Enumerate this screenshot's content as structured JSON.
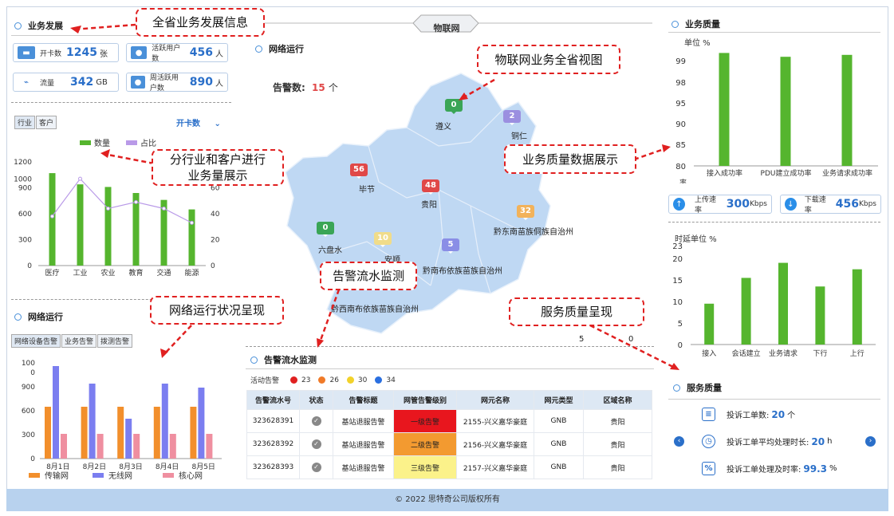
{
  "left": {
    "business": {
      "title": "业务发展",
      "cards": [
        {
          "label": "开卡数",
          "value": "1245",
          "unit": "张",
          "icon": "card-icon"
        },
        {
          "label": "活跃用户数",
          "value": "456",
          "unit": "人",
          "icon": "user-icon"
        },
        {
          "label": "流量",
          "value": "342",
          "unit": "GB",
          "icon": "pulse-icon"
        },
        {
          "label": "周活跃用户数",
          "value": "890",
          "unit": "人",
          "icon": "user-week-icon"
        }
      ],
      "tabs": [
        "行业",
        "客户"
      ],
      "dropdown": "开卡数"
    },
    "network": {
      "title": "网络运行",
      "tabs": [
        "网络设备告警",
        "业务告警",
        "拨测告警"
      ]
    }
  },
  "center": {
    "banner": "物联网",
    "network_title": "网络运行",
    "alarm_label": "告警数:",
    "alarm_value": "15",
    "alarm_unit": "个",
    "map": {
      "regions": [
        {
          "name": "遵义",
          "count": "0",
          "color": "#3aa556"
        },
        {
          "name": "铜仁",
          "count": "2",
          "color": "#9b8fe0"
        },
        {
          "name": "毕节",
          "count": "56",
          "color": "#e04848"
        },
        {
          "name": "贵阳",
          "count": "48",
          "color": "#e04848"
        },
        {
          "name": "黔东南苗族侗族自治州",
          "count": "32",
          "color": "#f2b25a"
        },
        {
          "name": "六盘水",
          "count": "0",
          "color": "#3aa556"
        },
        {
          "name": "安顺",
          "count": "10",
          "color": "#f0dc8a"
        },
        {
          "name": "黔南布依族苗族自治州",
          "count": "5",
          "color": "#8a8ee6"
        },
        {
          "name": "黔西南布依族苗族自治州",
          "count": "",
          "color": ""
        }
      ],
      "scale_values": [
        "5",
        "0"
      ]
    },
    "alarm_stream": {
      "title": "告警流水监测",
      "active_label": "活动告警",
      "legend": [
        {
          "value": "23",
          "color": "#e02020"
        },
        {
          "value": "26",
          "color": "#f07a28"
        },
        {
          "value": "30",
          "color": "#f2d22a"
        },
        {
          "value": "34",
          "color": "#2a6fe0"
        }
      ],
      "columns": [
        "告警流水号",
        "状态",
        "告警标题",
        "网管告警级别",
        "网元名称",
        "网元类型",
        "区域名称"
      ],
      "rows": [
        {
          "id": "323628391",
          "title": "基站退服告警",
          "level": "一级告警",
          "level_color": "#e8161e",
          "ne": "2155-兴义嘉华豪庭",
          "type": "GNB",
          "area": "贵阳"
        },
        {
          "id": "323628392",
          "title": "基站退服告警",
          "level": "二级告警",
          "level_color": "#f39a30",
          "ne": "2156-兴义嘉华豪庭",
          "type": "GNB",
          "area": "贵阳"
        },
        {
          "id": "323628393",
          "title": "基站退服告警",
          "level": "三级告警",
          "level_color": "#fbf28a",
          "ne": "2157-兴义嘉华豪庭",
          "type": "GNB",
          "area": "贵阳"
        }
      ]
    }
  },
  "right": {
    "quality": {
      "title": "业务质量",
      "unit": "单位 %",
      "upload_label": "上传速率",
      "upload_value": "300",
      "upload_unit": "Kbps",
      "download_label": "下载速率",
      "download_value": "456",
      "download_unit": "Kbps",
      "delay_unit": "时延单位 %"
    },
    "service": {
      "title": "服务质量",
      "items": [
        {
          "label": "投诉工单数:",
          "value": "20",
          "unit": "个",
          "icon": "clipboard-icon"
        },
        {
          "label": "投诉工单平均处理时长:",
          "value": "20",
          "unit": "h",
          "icon": "clock-icon"
        },
        {
          "label": "投诉工单处理及时率:",
          "value": "99.3",
          "unit": "%",
          "icon": "percent-icon"
        }
      ]
    }
  },
  "callouts": {
    "province": "全省业务发展信息",
    "industry": "分行业和客户进行\n业务量展示",
    "net_status": "网络运行状况呈现",
    "iot_view": "物联网业务全省视图",
    "quality_show": "业务质量数据展示",
    "alarm_monitor": "告警流水监测",
    "service_show": "服务质量呈现"
  },
  "footer": "© 2022 思特奇公司版权所有",
  "chart_data": [
    {
      "type": "bar",
      "title": "",
      "categories": [
        "医疗",
        "工业",
        "农业",
        "教育",
        "交通",
        "能源"
      ],
      "series": [
        {
          "name": "数量",
          "values": [
            1070,
            940,
            910,
            840,
            760,
            650
          ],
          "color": "#55b52e"
        },
        {
          "name": "占比",
          "type": "line",
          "values": [
            38,
            67,
            44,
            49,
            44,
            33
          ],
          "axis": "right",
          "color": "#b99ae8"
        }
      ],
      "ylim": [
        0,
        1200
      ],
      "yticks": [
        0,
        300,
        600,
        900,
        1000,
        1200
      ],
      "y2lim": [
        0,
        80
      ],
      "y2ticks": [
        0,
        20,
        40,
        60
      ],
      "legend": "top"
    },
    {
      "type": "bar",
      "title": "",
      "categories": [
        "8月1日",
        "8月2日",
        "8月3日",
        "8月4日",
        "8月5日"
      ],
      "series": [
        {
          "name": "传输网",
          "values": [
            650,
            650,
            650,
            650,
            650
          ],
          "color": "#f28f2c"
        },
        {
          "name": "无线网",
          "values": [
            1160,
            940,
            500,
            940,
            890
          ],
          "color": "#7b7ef0"
        },
        {
          "name": "核心网",
          "values": [
            310,
            310,
            310,
            310,
            310
          ],
          "color": "#ef8fa0"
        }
      ],
      "yticks": [
        "0",
        "300",
        "600",
        "900",
        "0",
        "100"
      ],
      "legend": "bottom"
    },
    {
      "type": "bar",
      "title": "",
      "categories": [
        "接入成功率",
        "PDU建立成功率",
        "业务请求成功率"
      ],
      "values": [
        99.4,
        99.2,
        99.3
      ],
      "ylim": [
        80,
        100
      ],
      "yticks": [
        80,
        85,
        90,
        95,
        98,
        99,
        100
      ],
      "color": "#55b52e"
    },
    {
      "type": "bar",
      "title": "",
      "categories": [
        "接入",
        "会话建立",
        "业务请求",
        "下行",
        "上行"
      ],
      "values": [
        9.5,
        15.5,
        19,
        13.5,
        17.5
      ],
      "ylim": [
        0,
        23
      ],
      "yticks": [
        0,
        5,
        10,
        15,
        20,
        23
      ],
      "color": "#55b52e"
    }
  ]
}
